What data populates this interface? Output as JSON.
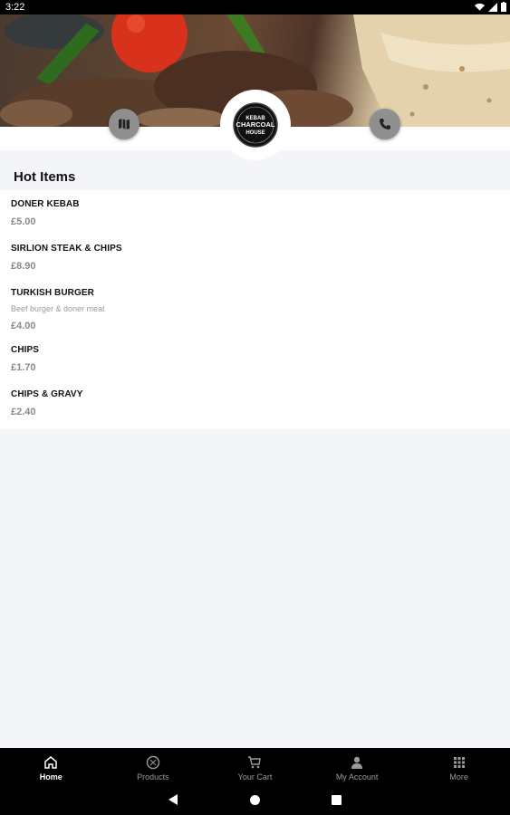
{
  "status_bar": {
    "time": "3:22"
  },
  "hero": {
    "image": "kebab-photo",
    "map_icon": "map-icon",
    "phone_icon": "phone-icon",
    "logo_text": "KEBAB CHARCOAL HOUSE"
  },
  "section": {
    "title": "Hot Items"
  },
  "items": [
    {
      "name": "DONER KEBAB",
      "description": "",
      "price": "£5.00"
    },
    {
      "name": "SIRLION STEAK & CHIPS",
      "description": "",
      "price": "£8.90"
    },
    {
      "name": "TURKISH BURGER",
      "description": "Beef burger & doner meat",
      "price": "£4.00"
    },
    {
      "name": "CHIPS",
      "description": "",
      "price": "£1.70"
    },
    {
      "name": "CHIPS & GRAVY",
      "description": "",
      "price": "£2.40"
    }
  ],
  "bottom_nav": [
    {
      "label": "Home",
      "icon": "home-icon",
      "active": true
    },
    {
      "label": "Products",
      "icon": "products-icon",
      "active": false
    },
    {
      "label": "Your Cart",
      "icon": "cart-icon",
      "active": false
    },
    {
      "label": "My Account",
      "icon": "account-icon",
      "active": false
    },
    {
      "label": "More",
      "icon": "grid-icon",
      "active": false
    }
  ]
}
